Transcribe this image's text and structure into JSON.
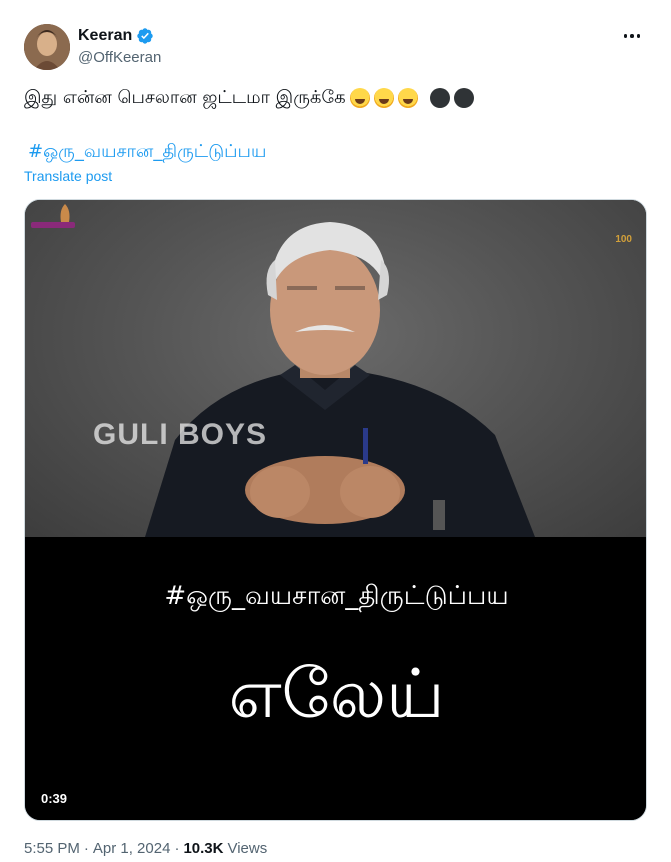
{
  "author": {
    "display_name": "Keeran",
    "handle": "@OffKeeran",
    "verified": true,
    "avatar_icon": "avatar-portrait"
  },
  "tweet": {
    "text": "இது என்ன பெசலான ஜட்டமா இருக்கே",
    "emojis": [
      "face-with-tears-of-joy",
      "face-with-tears-of-joy",
      "face-with-tears-of-joy",
      "dark-circle",
      "dark-circle"
    ],
    "hashtag": "#ஒரு_வயசான_திருட்டுப்பய",
    "translate_label": "Translate post"
  },
  "media": {
    "type": "video",
    "watermark": "GULI   BOYS",
    "caption_hashtag": "#ஒரு_வயசான_திருட்டுப்பய",
    "caption_main": "எலேய்",
    "channel_logo_text": "100",
    "duration": "0:39"
  },
  "meta": {
    "time": "5:55 PM",
    "separator": "·",
    "date": "Apr 1, 2024",
    "views_count": "10.3K",
    "views_label": "Views"
  },
  "colors": {
    "accent": "#1d9bf0",
    "text_primary": "#0f1419",
    "text_secondary": "#536471"
  }
}
